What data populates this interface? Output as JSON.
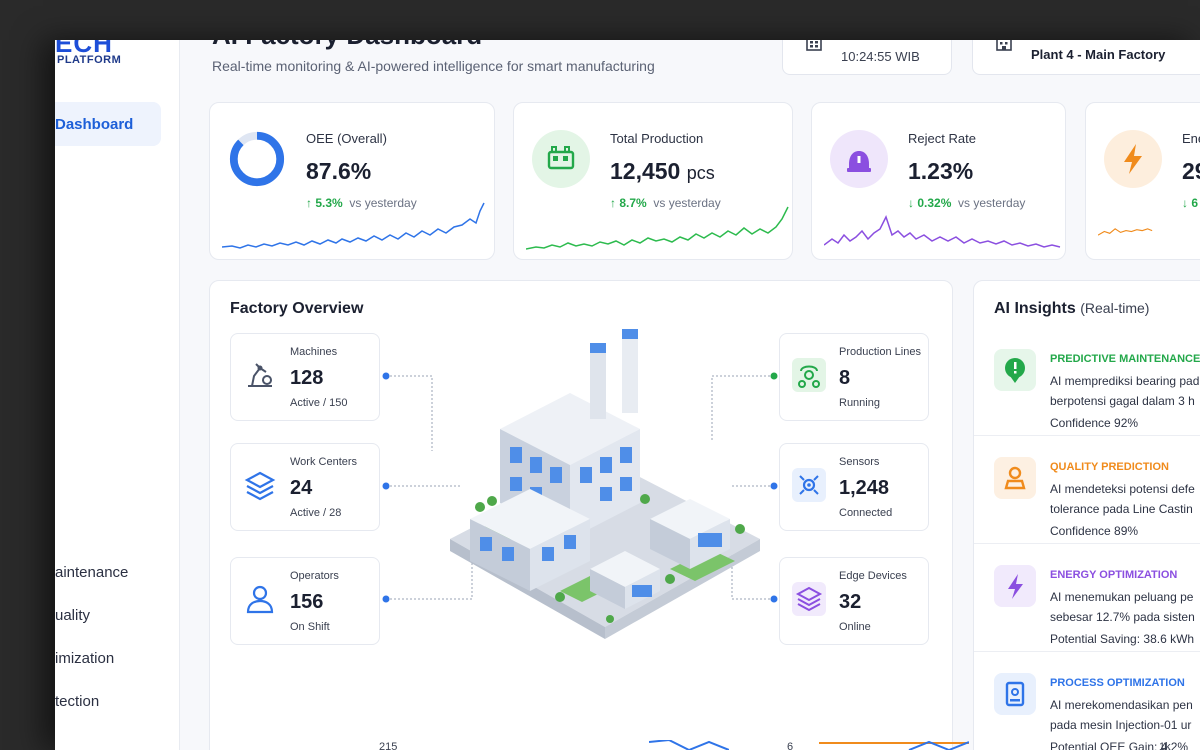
{
  "brand": {
    "top": "ECH",
    "sub": "PLATFORM"
  },
  "sidebar": {
    "active": "Dashboard",
    "items": [
      "aintenance",
      "uality",
      "imization",
      "tection"
    ]
  },
  "header": {
    "title": "AI Factory Dashboard",
    "subtitle": "Real-time monitoring & AI-powered intelligence for smart manufacturing",
    "time": "10:24:55 WIB",
    "plant": "Plant 4 - Main Factory"
  },
  "kpis": [
    {
      "label": "OEE (Overall)",
      "value": "87.6%",
      "unit": "",
      "delta": "5.3%",
      "delta_dir": "up",
      "delta_text": "vs yesterday",
      "color": "#2f74e8",
      "progress": 0.876
    },
    {
      "label": "Total Production",
      "value": "12,450",
      "unit": "pcs",
      "delta": "8.7%",
      "delta_dir": "up",
      "delta_text": "vs yesterday",
      "color": "#2dbb4e"
    },
    {
      "label": "Reject Rate",
      "value": "1.23%",
      "unit": "",
      "delta": "0.32%",
      "delta_dir": "down",
      "delta_text": "vs yesterday",
      "color": "#8b4fe0"
    },
    {
      "label": "Ener",
      "value": "29",
      "unit": "",
      "delta": "6",
      "delta_dir": "down",
      "delta_text": "",
      "color": "#f08b1c"
    }
  ],
  "overview": {
    "title": "Factory Overview",
    "metrics": [
      {
        "label": "Machines",
        "value": "128",
        "sub": "Active / 150"
      },
      {
        "label": "Work Centers",
        "value": "24",
        "sub": "Active / 28"
      },
      {
        "label": "Operators",
        "value": "156",
        "sub": "On Shift"
      },
      {
        "label": "Production Lines",
        "value": "8",
        "sub": "Running"
      },
      {
        "label": "Sensors",
        "value": "1,248",
        "sub": "Connected"
      },
      {
        "label": "Edge Devices",
        "value": "32",
        "sub": "Online"
      }
    ]
  },
  "insights": {
    "title": "AI Insights",
    "title_suffix": "(Real-time)",
    "items": [
      {
        "head": "PREDICTIVE MAINTENANCE",
        "l1": "AI memprediksi bearing pad",
        "l2": "berpotensi gagal dalam 3 h",
        "l3": "Confidence 92%",
        "color": "#23a84a",
        "bg": "#e6f6ea"
      },
      {
        "head": "QUALITY PREDICTION",
        "l1": "AI mendeteksi potensi defe",
        "l2": "tolerance pada Line Castin",
        "l3": "Confidence 89%",
        "color": "#f08b1c",
        "bg": "#fdf0e2"
      },
      {
        "head": "ENERGY OPTIMIZATION",
        "l1": "AI menemukan peluang pe",
        "l2": "sebesar 12.7% pada sisten",
        "l3": "Potential Saving: 38.6 kWh",
        "color": "#8b4fe0",
        "bg": "#f1eafc"
      },
      {
        "head": "PROCESS OPTIMIZATION",
        "l1": "AI merekomendasikan pen",
        "l2": "pada mesin Injection-01 ur",
        "l3": "Potential OEE Gain: 4.2%",
        "color": "#2f74e8",
        "bg": "#e8f0fd"
      }
    ]
  },
  "bottom": {
    "a": "215",
    "b": "6",
    "c": "1k"
  }
}
